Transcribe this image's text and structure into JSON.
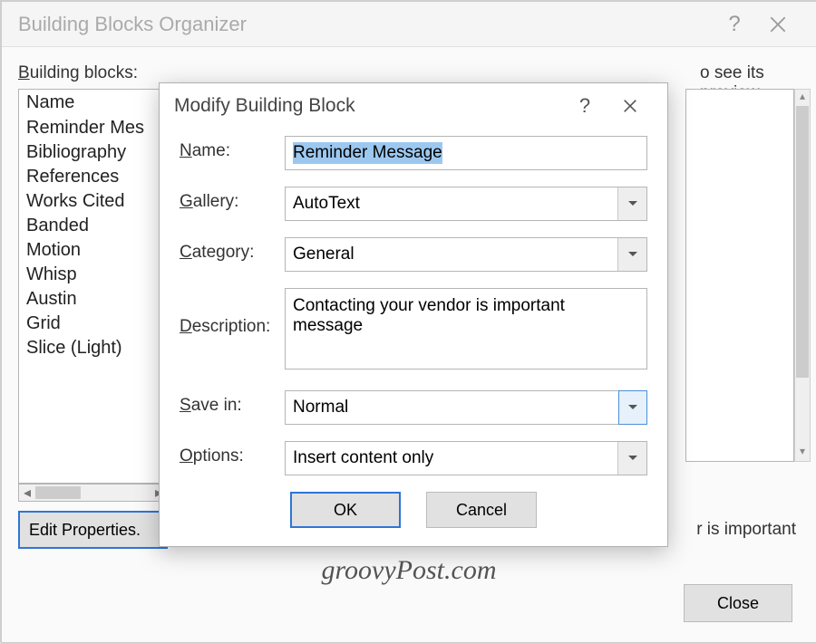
{
  "organizer": {
    "title": "Building Blocks Organizer",
    "help_symbol": "?",
    "list_label": "Building blocks:",
    "preview_label": "o see its preview",
    "column_header": "Name",
    "items": [
      "Reminder Mes",
      "Bibliography",
      "References",
      "Works Cited",
      "Banded",
      "Motion",
      "Whisp",
      "Austin",
      "Grid",
      "Slice (Light)"
    ],
    "edit_button": "Edit Properties.",
    "desc_snippet": "r is important",
    "close_button": "Close"
  },
  "modify": {
    "title": "Modify Building Block",
    "help_symbol": "?",
    "labels": {
      "name": "Name:",
      "gallery": "Gallery:",
      "category": "Category:",
      "description": "Description:",
      "save_in": "Save in:",
      "options": "Options:"
    },
    "values": {
      "name": "Reminder Message",
      "gallery": "AutoText",
      "category": "General",
      "description": "Contacting your vendor is important message",
      "save_in": "Normal",
      "options": "Insert content only"
    },
    "buttons": {
      "ok": "OK",
      "cancel": "Cancel"
    }
  },
  "watermark": "groovyPost.com"
}
